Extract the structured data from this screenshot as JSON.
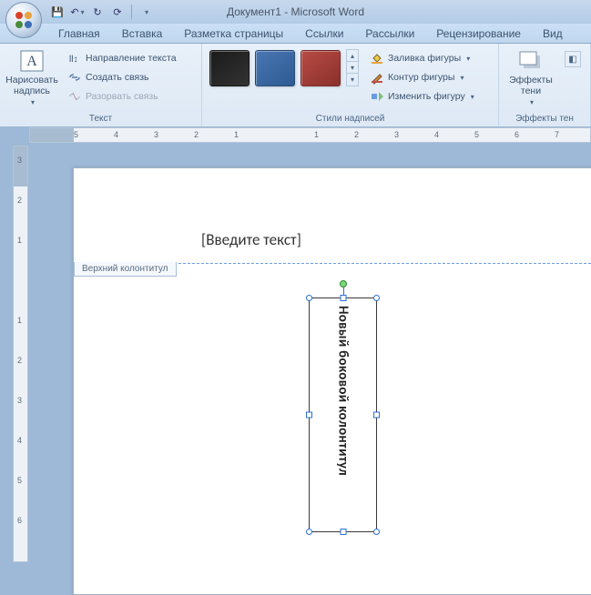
{
  "title": "Документ1 - Microsoft Word",
  "qat": {
    "save": "💾",
    "undo": "↶",
    "redo": "↻",
    "refresh": "⟳"
  },
  "tabs": [
    "Главная",
    "Вставка",
    "Разметка страницы",
    "Ссылки",
    "Рассылки",
    "Рецензирование",
    "Вид"
  ],
  "ribbon": {
    "text_group": {
      "draw_textbox": "Нарисовать\nнадпись",
      "text_direction": "Направление текста",
      "create_link": "Создать связь",
      "break_link": "Разорвать связь",
      "label": "Текст"
    },
    "styles_group": {
      "swatches": [
        "#1a1a1a",
        "#4a77b4",
        "#b84b45"
      ],
      "shape_fill": "Заливка фигуры",
      "shape_outline": "Контур фигуры",
      "change_shape": "Изменить фигуру",
      "label": "Стили надписей"
    },
    "effects_group": {
      "shadow_effects": "Эффекты\nтени",
      "label": "Эффекты тен"
    }
  },
  "ruler": {
    "h": [
      "5",
      "4",
      "3",
      "2",
      "1",
      "",
      "1",
      "2",
      "3",
      "4",
      "5",
      "6",
      "7"
    ],
    "v": [
      "3",
      "2",
      "1",
      "",
      "1",
      "2",
      "3",
      "4",
      "5",
      "6"
    ]
  },
  "document": {
    "placeholder": "[Введите текст]",
    "header_tag": "Верхний колонтитул",
    "textbox_text": "Новый боковой колонтитул"
  }
}
